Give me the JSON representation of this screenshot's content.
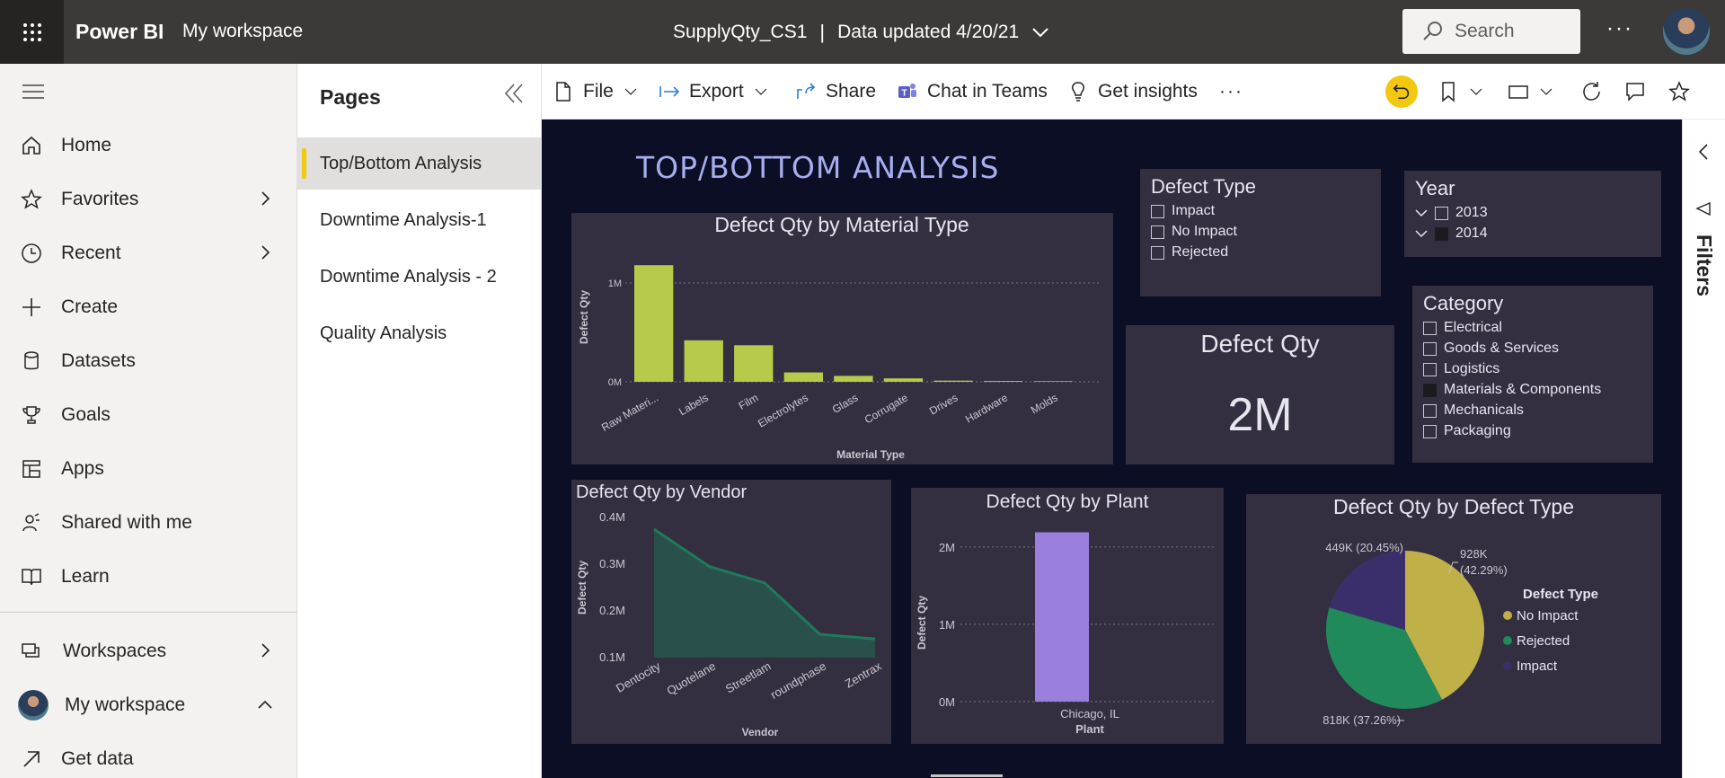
{
  "topbar": {
    "brand": "Power BI",
    "workspace": "My workspace",
    "report_name": "SupplyQty_CS1",
    "separator": "|",
    "data_updated": "Data updated 4/20/21",
    "search_placeholder": "Search",
    "more": "···"
  },
  "nav": {
    "items": [
      {
        "label": "Home",
        "icon": "home-icon"
      },
      {
        "label": "Favorites",
        "icon": "star-icon"
      },
      {
        "label": "Recent",
        "icon": "clock-icon"
      },
      {
        "label": "Create",
        "icon": "plus-icon"
      },
      {
        "label": "Datasets",
        "icon": "database-icon"
      },
      {
        "label": "Goals",
        "icon": "trophy-icon"
      },
      {
        "label": "Apps",
        "icon": "apps-icon"
      },
      {
        "label": "Shared with me",
        "icon": "shared-user-icon"
      },
      {
        "label": "Learn",
        "icon": "book-icon"
      },
      {
        "label": "Workspaces",
        "icon": "workspaces-icon"
      },
      {
        "label": "My workspace",
        "icon": "avatar"
      },
      {
        "label": "Get data",
        "icon": "arrow-upright-icon"
      }
    ]
  },
  "pages": {
    "title": "Pages",
    "items": [
      "Top/Bottom Analysis",
      "Downtime Analysis-1",
      "Downtime Analysis - 2",
      "Quality Analysis"
    ],
    "active": "Top/Bottom Analysis"
  },
  "toolbar": {
    "file": "File",
    "export": "Export",
    "share": "Share",
    "chat_in_teams": "Chat in Teams",
    "get_insights": "Get insights",
    "more": "···"
  },
  "filters_label": "Filters",
  "report": {
    "title": "TOP/BOTTOM ANALYSIS",
    "defect_type_slicer": {
      "title": "Defect Type",
      "items": [
        "Impact",
        "No Impact",
        "Rejected"
      ]
    },
    "year_slicer": {
      "title": "Year",
      "items": [
        "2013",
        "2014"
      ],
      "selected": "2014"
    },
    "category_slicer": {
      "title": "Category",
      "items": [
        "Electrical",
        "Goods & Services",
        "Logistics",
        "Materials & Components",
        "Mechanicals",
        "Packaging"
      ],
      "selected": "Materials & Components"
    },
    "kpi": {
      "title": "Defect Qty",
      "value": "2M"
    }
  },
  "chart_data": [
    {
      "type": "bar",
      "title": "Defect Qty by Material Type",
      "xlabel": "Material Type",
      "ylabel": "Defect Qty",
      "categories": [
        "Raw Materi...",
        "Labels",
        "Film",
        "Electrolytes",
        "Glass",
        "Corrugate",
        "Drives",
        "Hardware",
        "Molds"
      ],
      "values": [
        1180000,
        420000,
        370000,
        95000,
        60000,
        35000,
        12000,
        8000,
        6000
      ],
      "yticks": [
        "0M",
        "1M"
      ],
      "ylim": [
        0,
        1300000
      ],
      "color": "#b9c94a"
    },
    {
      "type": "area",
      "title": "Defect Qty by Vendor",
      "xlabel": "Vendor",
      "ylabel": "Defect Qty",
      "categories": [
        "Dentocity",
        "Quotelane",
        "Streetlam",
        "roundphase",
        "Zentrax"
      ],
      "values": [
        375000,
        295000,
        260000,
        150000,
        140000
      ],
      "yticks": [
        "0.1M",
        "0.2M",
        "0.3M",
        "0.4M"
      ],
      "ylim": [
        100000,
        400000
      ],
      "color": "#1e7a5a"
    },
    {
      "type": "bar",
      "title": "Defect Qty by Plant",
      "xlabel": "Plant",
      "ylabel": "Defect Qty",
      "categories": [
        "Chicago, IL"
      ],
      "values": [
        2190000
      ],
      "yticks": [
        "0M",
        "1M",
        "2M"
      ],
      "ylim": [
        0,
        2300000
      ],
      "color": "#9b7fdc"
    },
    {
      "type": "pie",
      "title": "Defect Qty by Defect Type",
      "legend_title": "Defect Type",
      "slices": [
        {
          "name": "No Impact",
          "value": 928000,
          "label": "928K (42.29%)",
          "color": "#bfb048"
        },
        {
          "name": "Rejected",
          "value": 818000,
          "label": "818K (37.26%)",
          "color": "#218a5a"
        },
        {
          "name": "Impact",
          "value": 449000,
          "label": "449K (20.45%)",
          "color": "#3b2f6b"
        }
      ]
    }
  ]
}
